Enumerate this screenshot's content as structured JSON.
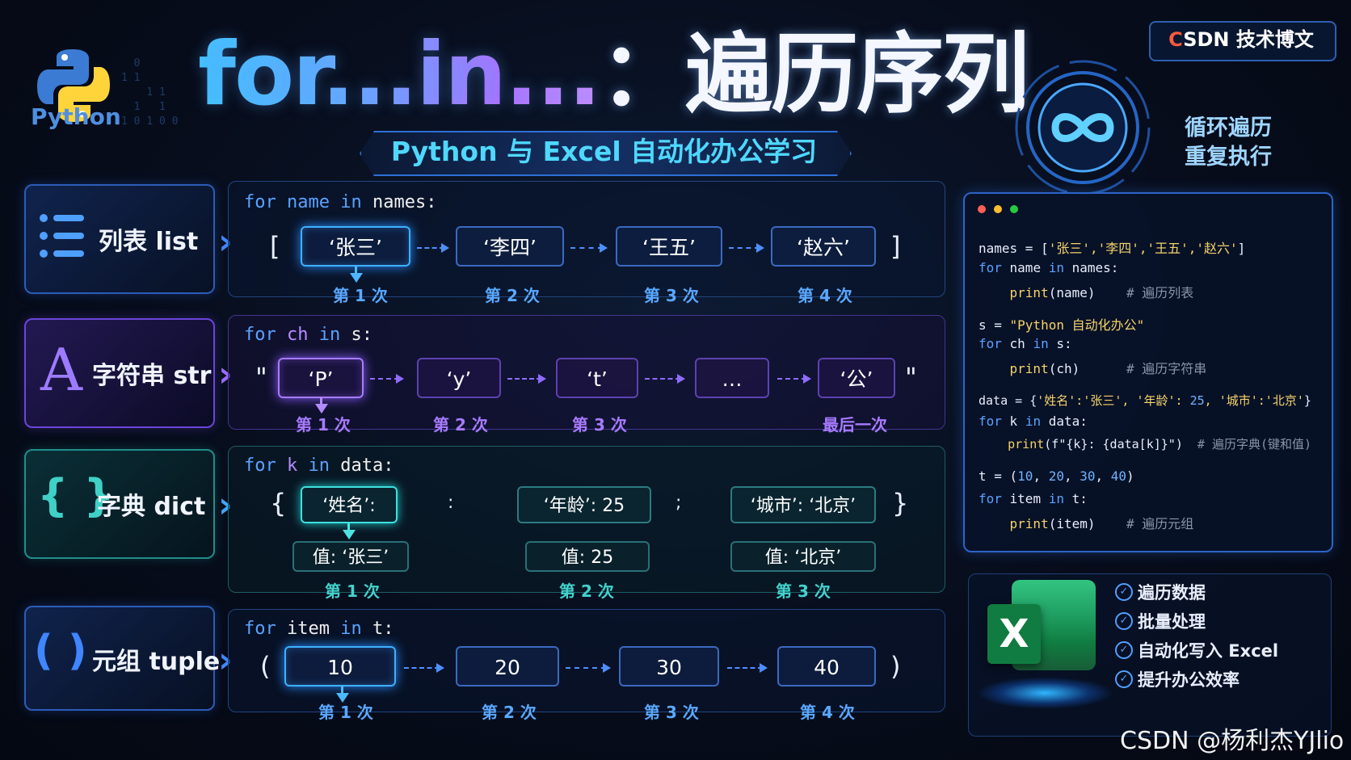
{
  "header": {
    "logo_text": "Python",
    "title_part1": "for...in...",
    "title_part2": "：遍历序列",
    "subtitle": "Python 与 Excel 自动化办公学习",
    "badge_c": "C",
    "badge_rest": "SDN 技术博文",
    "loop_line1": "循环遍历",
    "loop_line2": "重复执行"
  },
  "rows": {
    "list": {
      "label": "列表 list",
      "code_kw1": "for",
      "code_var": "name",
      "code_kw2": "in",
      "code_seq": "names:",
      "open": "[",
      "close": "]",
      "items": [
        "‘张三’",
        "‘李四’",
        "‘王五’",
        "‘赵六’"
      ],
      "counts": [
        "第 1 次",
        "第 2 次",
        "第 3 次",
        "第 4 次"
      ]
    },
    "str": {
      "icon_letter": "A",
      "label": "字符串 str",
      "code_kw1": "for",
      "code_var": "ch",
      "code_kw2": "in",
      "code_seq": "s:",
      "open": "\"",
      "close": "\"",
      "items": [
        "‘P’",
        "‘y’",
        "‘t’",
        "…",
        "‘公’"
      ],
      "counts": [
        "第 1 次",
        "第 2 次",
        "第 3 次",
        "最后一次"
      ]
    },
    "dict": {
      "icon": "{ }",
      "label": "字典 dict",
      "code_kw1": "for",
      "code_var": "k",
      "code_kw2": "in",
      "code_seq": "data:",
      "open": "{",
      "close": "}",
      "sep1": ":",
      "sep2": ";",
      "keys": [
        "‘姓名’:",
        "‘年龄’: 25",
        "‘城市’: ‘北京’"
      ],
      "values": [
        "值: ‘张三’",
        "值: 25",
        "值: ‘北京’"
      ],
      "counts": [
        "第 1 次",
        "第 2 次",
        "第 3 次"
      ]
    },
    "tuple": {
      "icon": "( )",
      "label": "元组 tuple",
      "code_kw1": "for",
      "code_var": "item",
      "code_kw2": "in",
      "code_seq": "t:",
      "open": "(",
      "close": ")",
      "items": [
        "10",
        "20",
        "30",
        "40"
      ],
      "counts": [
        "第 1 次",
        "第 2 次",
        "第 3 次",
        "第 4 次"
      ]
    }
  },
  "code_window": {
    "l1a": "names = [",
    "l1b": "'张三','李四','王五','赵六'",
    "l1c": "]",
    "l2a": "for",
    "l2b": " name ",
    "l2c": "in",
    "l2d": " names:",
    "l3a": "    print",
    "l3b": "(name)",
    "l3c": "    # 遍历列表",
    "l4a": "s = ",
    "l4b": "\"Python 自动化办公\"",
    "l5a": "for",
    "l5b": " ch ",
    "l5c": "in",
    "l5d": " s:",
    "l6a": "    print",
    "l6b": "(ch)",
    "l6c": "      # 遍历字符串",
    "l7a": "data = {",
    "l7b": "'姓名':'张三', '年龄': ",
    "l7n": "25",
    "l7c": ", '城市':'北京'",
    "l7d": "}",
    "l8a": "for",
    "l8b": " k ",
    "l8c": "in",
    "l8d": " data:",
    "l9a": "    print",
    "l9b": "(f\"{k}: {data[k]}\")",
    "l9c": "  # 遍历字典(键和值)",
    "l10a": "t = (",
    "l10n1": "10",
    "l10s1": ", ",
    "l10n2": "20",
    "l10s2": ", ",
    "l10n3": "30",
    "l10s3": ", ",
    "l10n4": "40",
    "l10c": ")",
    "l11a": "for",
    "l11b": " item ",
    "l11c": "in",
    "l11d": " t:",
    "l12a": "    print",
    "l12b": "(item)",
    "l12c": "    # 遍历元组"
  },
  "excel": {
    "letter": "X",
    "features": [
      "遍历数据",
      "批量处理",
      "自动化写入 Excel",
      "提升办公效率"
    ]
  },
  "watermark": "CSDN @杨利杰YJlio",
  "colors": {
    "accent_blue": "#4f9fff",
    "accent_purple": "#a77bff",
    "accent_teal": "#43d2cc",
    "csdn_red": "#ff5a3c"
  }
}
